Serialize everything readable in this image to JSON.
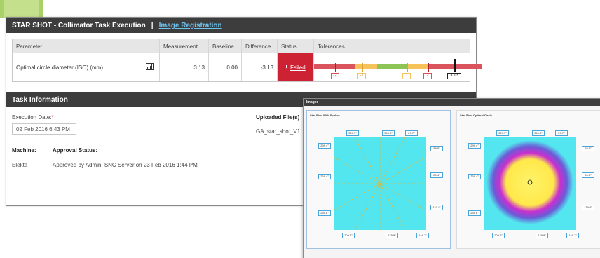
{
  "window": {
    "title": "STAR SHOT - Collimator Task Execution",
    "separator": "|",
    "link": "Image Registration"
  },
  "results": {
    "headers": [
      "Parameter",
      "Measurement",
      "Baseline",
      "Difference",
      "Status",
      "Tolerances"
    ],
    "row": {
      "parameter": "Optimal circle diameter (ISO) (mm)",
      "measurement": "3.13",
      "baseline": "0.00",
      "difference": "-3.13",
      "status_icon": "!",
      "status": "Failed"
    },
    "tolerance_labels": [
      "-2",
      "-1",
      "1",
      "2",
      "3.13"
    ],
    "tolerance_colors": {
      "fail": "#d9545c",
      "warn": "#f7c25a",
      "pass": "#8cc456"
    }
  },
  "task_info": {
    "title": "Task Information",
    "execution_date_label": "Execution Date:",
    "required_mark": "*",
    "execution_date": "02 Feb 2016 6:43 PM",
    "uploaded_label": "Uploaded File(s)",
    "uploaded_file": "GA_star_shot_V1",
    "machine_label": "Machine:",
    "approval_label": "Approval Status:",
    "machine": "Elekta",
    "approval": "Approved by Admin, SNC Server on 23 Feb 2016 1:44 PM"
  },
  "images": {
    "title": "Images",
    "left_title": "Star Shot With Spokes",
    "right_title": "Star Shot Optimal Circle",
    "angles": [
      "329.7°",
      "359.8°",
      "29.7°",
      "299.4°",
      "58.8°",
      "269.4°",
      "89.4°",
      "239.8°",
      "119.4°",
      "209.7°",
      "179.8°",
      "149.7°"
    ]
  }
}
